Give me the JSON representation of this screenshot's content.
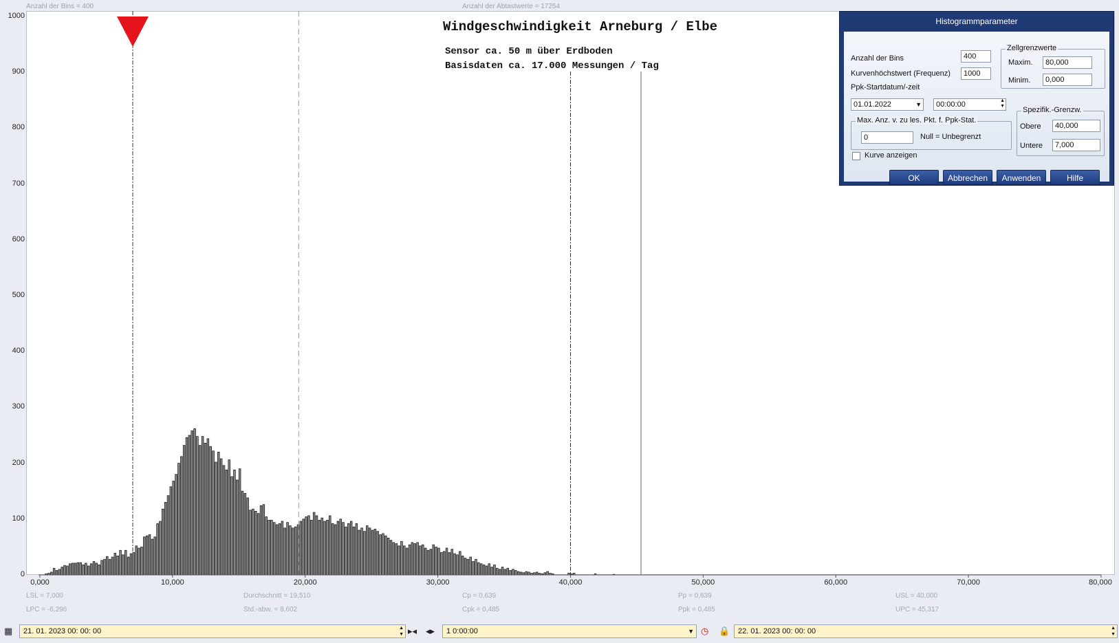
{
  "header_info": {
    "bins_label": "Anzahl der Bins = 400",
    "samples_label": "Anzahl der Abtastwerte = 17254"
  },
  "chart_data": {
    "type": "bar",
    "title": "Windgeschwindigkeit  Arneburg / Elbe",
    "subtitle_lines": [
      "Sensor ca. 50 m über Erdboden",
      "Basisdaten ca. 17.000 Messungen / Tag"
    ],
    "xlim": [
      0,
      80
    ],
    "ylim": [
      0,
      1000
    ],
    "y_ticks": [
      "0",
      "100",
      "200",
      "300",
      "400",
      "500",
      "600",
      "700",
      "800",
      "900",
      "1000"
    ],
    "x_ticks": [
      "0,000",
      "10,000",
      "20,000",
      "30,000",
      "40,000",
      "50,000",
      "60,000",
      "70,000",
      "80,000"
    ],
    "bin_width": 0.2,
    "bins_start": 0.4,
    "values": [
      2,
      3,
      5,
      12,
      8,
      10,
      14,
      17,
      16,
      20,
      21,
      21,
      22,
      22,
      18,
      21,
      16,
      20,
      24,
      21,
      18,
      26,
      28,
      33,
      28,
      32,
      39,
      34,
      44,
      36,
      44,
      32,
      38,
      40,
      52,
      48,
      50,
      68,
      70,
      72,
      64,
      68,
      92,
      96,
      118,
      130,
      142,
      158,
      168,
      180,
      200,
      212,
      232,
      246,
      250,
      258,
      262,
      248,
      232,
      248,
      236,
      244,
      230,
      222,
      202,
      220,
      208,
      196,
      188,
      206,
      176,
      188,
      170,
      190,
      150,
      146,
      138,
      116,
      118,
      114,
      110,
      124,
      126,
      104,
      98,
      98,
      94,
      90,
      92,
      96,
      84,
      94,
      88,
      84,
      86,
      90,
      96,
      100,
      104,
      106,
      98,
      112,
      106,
      98,
      102,
      96,
      98,
      106,
      92,
      90,
      96,
      100,
      94,
      86,
      92,
      96,
      86,
      92,
      80,
      84,
      78,
      88,
      84,
      80,
      82,
      78,
      72,
      74,
      70,
      66,
      62,
      58,
      56,
      52,
      60,
      52,
      48,
      54,
      58,
      56,
      58,
      52,
      54,
      48,
      44,
      46,
      54,
      50,
      48,
      40,
      42,
      48,
      40,
      46,
      38,
      36,
      42,
      34,
      30,
      28,
      32,
      24,
      28,
      22,
      20,
      18,
      16,
      20,
      14,
      18,
      12,
      10,
      14,
      10,
      12,
      8,
      10,
      8,
      6,
      5,
      4,
      6,
      5,
      3,
      4,
      5,
      3,
      2,
      4,
      6,
      3,
      2,
      0,
      0,
      0,
      0,
      0,
      3,
      2,
      3,
      0,
      0,
      0,
      0,
      0,
      0,
      0,
      2,
      0,
      0,
      0,
      0,
      0,
      0,
      1
    ],
    "markers": [
      {
        "name": "LSL",
        "x": 7.0
      },
      {
        "name": "Durchschnitt",
        "x": 19.51
      },
      {
        "name": "USL",
        "x": 40.0
      },
      {
        "name": "UPC",
        "x": 45.317
      }
    ]
  },
  "stats": {
    "lsl": "LSL = 7,000",
    "lpc": "LPC = -6,296",
    "mean": "Durchschnitt = 19,510",
    "std": "Std.-abw. = 8,602",
    "cp": "Cp = 0,639",
    "cpk": "Cpk = 0,485",
    "pp": "Pp = 0,639",
    "ppk": "Ppk = 0,485",
    "usl": "USL = 40,000",
    "upc": "UPC = 45,317"
  },
  "dialog": {
    "title": "Histogrammparameter",
    "bins_label": "Anzahl der Bins",
    "bins_value": "400",
    "curve_label": "Kurvenhöchstwert (Frequenz)",
    "curve_value": "1000",
    "ppk_label": "Ppk-Startdatum/-zeit",
    "date_value": "01.01.2022",
    "time_value": "00:00:00",
    "cell_group": "Zellgrenzwerte",
    "max_label": "Maxim.",
    "max_value": "80,000",
    "min_label": "Minim.",
    "min_value": "0,000",
    "maxpts_group": "Max. Anz. v. zu les. Pkt. f. Ppk-Stat.",
    "maxpts_value": "0",
    "maxpts_hint": "Null = Unbegrenzt",
    "spec_group": "Spezifik.-Grenzw.",
    "upper_label": "Obere",
    "upper_value": "40,000",
    "lower_label": "Untere",
    "lower_value": "7,000",
    "checkbox_label": "Kurve anzeigen",
    "ok_label": "OK",
    "cancel_label": "Abbrechen",
    "apply_label": "Anwenden",
    "help_label": "Hilfe"
  },
  "bottom": {
    "start_datetime": "21. 01. 2023    00: 00: 00",
    "interval": "1  0:00:00",
    "end_datetime": "22. 01. 2023    00: 00: 00"
  }
}
